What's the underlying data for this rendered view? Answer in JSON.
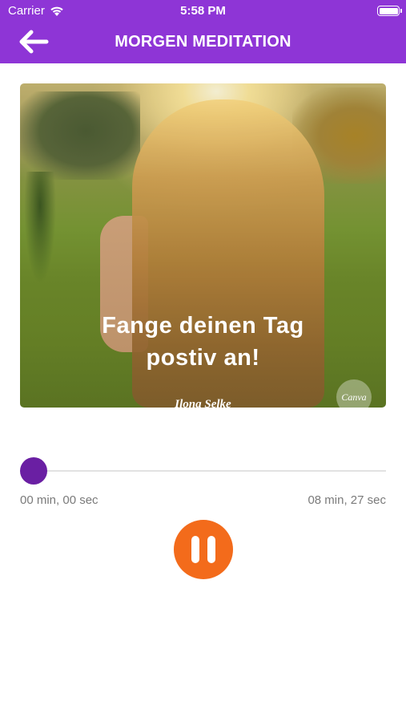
{
  "status_bar": {
    "carrier": "Carrier",
    "time": "5:58 PM"
  },
  "nav": {
    "title": "MORGEN MEDITATION",
    "back_icon": "arrow-left-icon"
  },
  "cover": {
    "text_line1": "Fange deinen Tag",
    "text_line2": "postiv an!",
    "author": "Ilona Selke",
    "badge": "Canva"
  },
  "player": {
    "elapsed": "00 min, 00 sec",
    "duration": "08 min, 27 sec",
    "progress": 0.0,
    "button_icon": "pause-icon"
  },
  "colors": {
    "header": "#8e35d6",
    "accent": "#6a1fa3",
    "play_button": "#f36b1b"
  }
}
